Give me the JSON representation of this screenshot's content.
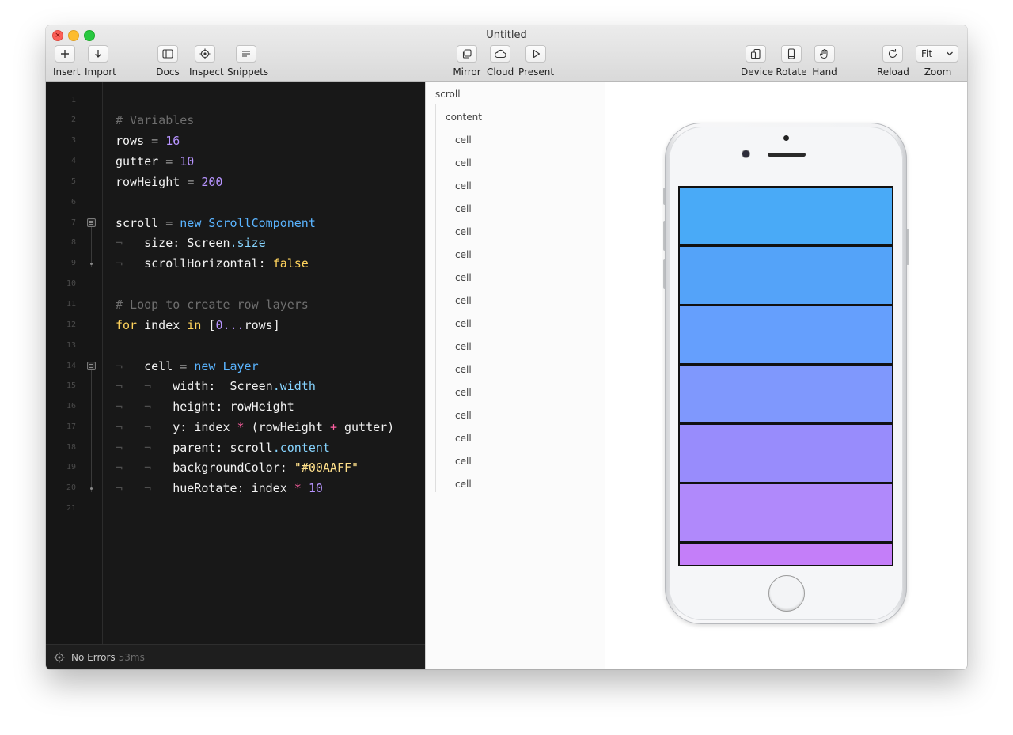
{
  "window": {
    "title": "Untitled"
  },
  "toolbar": {
    "insert": "Insert",
    "import": "Import",
    "docs": "Docs",
    "inspect": "Inspect",
    "snippets": "Snippets",
    "mirror": "Mirror",
    "cloud": "Cloud",
    "present": "Present",
    "device": "Device",
    "rotate": "Rotate",
    "hand": "Hand",
    "reload": "Reload",
    "zoom": "Zoom",
    "zoom_value": "Fit"
  },
  "editor": {
    "line_numbers": [
      "1",
      "2",
      "3",
      "4",
      "5",
      "6",
      "7",
      "8",
      "9",
      "10",
      "11",
      "12",
      "13",
      "14",
      "15",
      "16",
      "17",
      "18",
      "19",
      "20",
      "21"
    ],
    "code": {
      "comment_vars": "# Variables",
      "rows": "rows",
      "rows_val": "16",
      "gutter": "gutter",
      "gutter_val": "10",
      "rowHeight": "rowHeight",
      "rowHeight_val": "200",
      "scroll": "scroll",
      "new": "new",
      "ScrollComponent": "ScrollComponent",
      "size_key": "size:",
      "screen": "Screen",
      "size_prop": ".size",
      "scrollHorizontal_key": "scrollHorizontal:",
      "false": "false",
      "comment_loop": "# Loop to create row layers",
      "for": "for",
      "index": "index",
      "in": "in",
      "range_open": "[",
      "range_zero": "0",
      "range_dots": "...",
      "range_rows": "rows",
      "range_close": "]",
      "cell": "cell",
      "Layer": "Layer",
      "width_key": "width:",
      "width_prop": ".width",
      "height_key": "height:",
      "height_val": "rowHeight",
      "y_key": "y:",
      "y_index": "index",
      "y_mul": "*",
      "y_open": "(rowHeight",
      "y_plus": "+",
      "y_close": "gutter)",
      "parent_key": "parent:",
      "parent_obj": "scroll",
      "parent_prop": ".content",
      "bg_key": "backgroundColor:",
      "bg_val": "\"#00AAFF\"",
      "hue_key": "hueRotate:",
      "hue_index": "index",
      "hue_mul": "*",
      "hue_val": "10",
      "eq": "=",
      "tab": "¬"
    }
  },
  "status": {
    "text": "No Errors",
    "time": "53ms"
  },
  "layers": {
    "root": "scroll",
    "child": "content",
    "cells": [
      "cell",
      "cell",
      "cell",
      "cell",
      "cell",
      "cell",
      "cell",
      "cell",
      "cell",
      "cell",
      "cell",
      "cell",
      "cell",
      "cell",
      "cell",
      "cell"
    ]
  },
  "preview": {
    "cell_colors": [
      "#49aaf7",
      "#54a3f9",
      "#659ffd",
      "#7f98fd",
      "#988cfc",
      "#b089fb",
      "#c47ef9"
    ]
  }
}
